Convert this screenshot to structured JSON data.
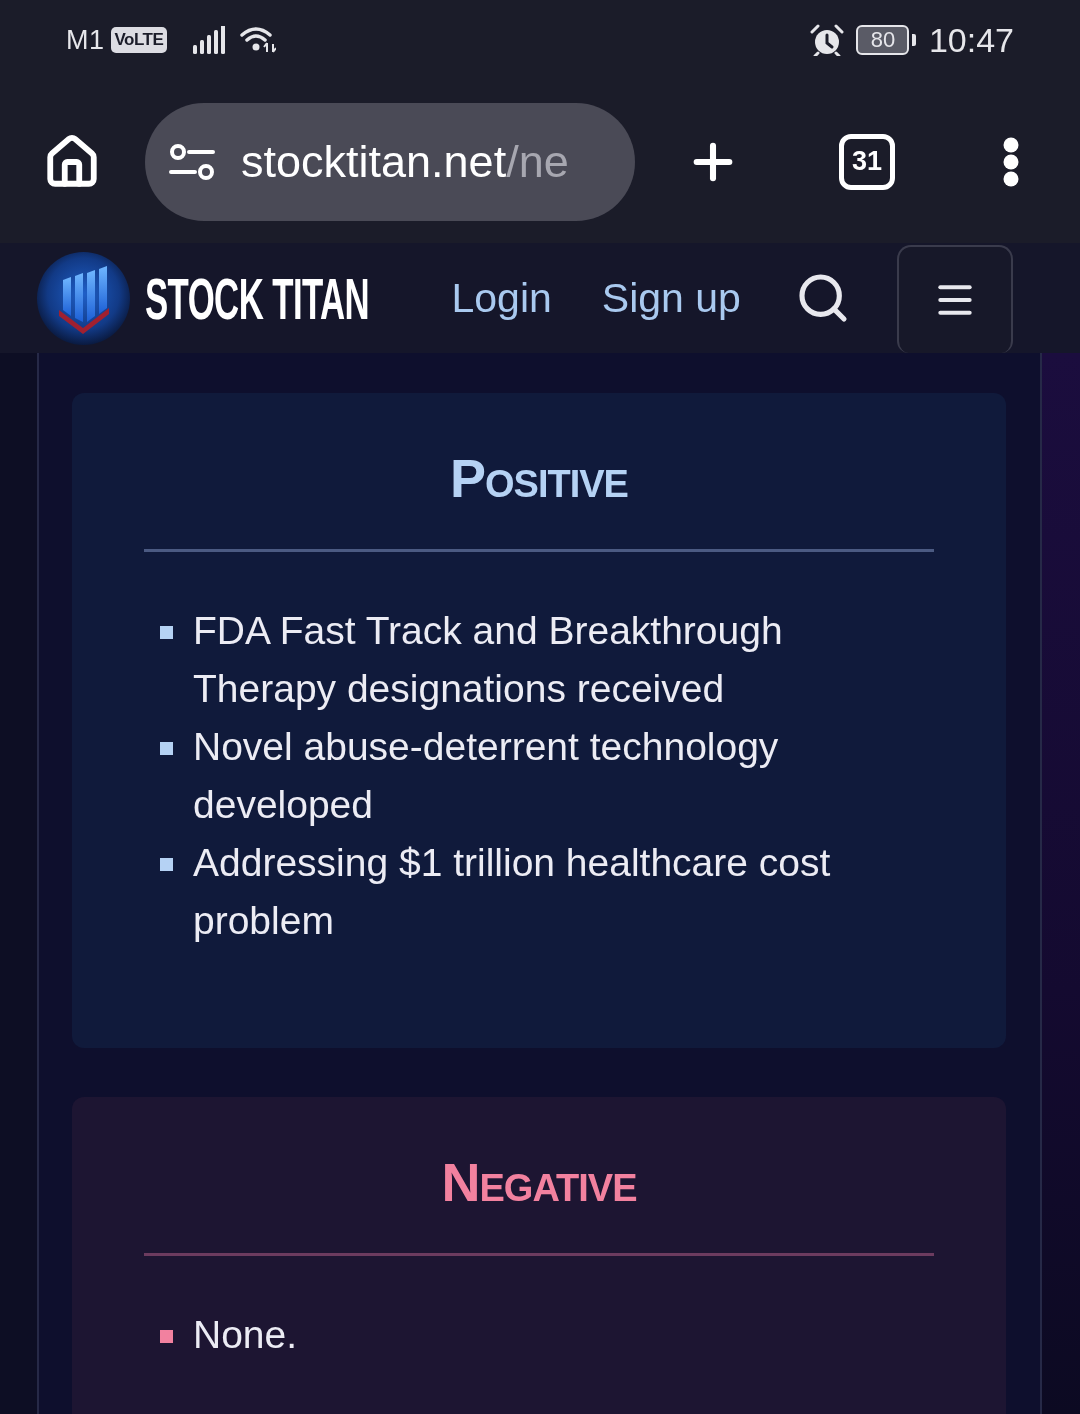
{
  "status_bar": {
    "carrier": "M1",
    "network_badge": "VoLTE",
    "battery": "80",
    "time": "10:47"
  },
  "browser_toolbar": {
    "url_host": "stocktitan.net",
    "url_path": "/ne",
    "tab_count": "31"
  },
  "site_header": {
    "brand": "STOCK TITAN",
    "links": [
      "Login",
      "Sign up"
    ]
  },
  "sentiment_cards": [
    {
      "kind": "positive",
      "title": "POSITIVE",
      "items": [
        "FDA Fast Track and Breakthrough Therapy designations received",
        "Novel abuse-deterrent technology developed",
        "Addressing $1 trillion healthcare cost problem"
      ]
    },
    {
      "kind": "negative",
      "title": "NEGATIVE",
      "items": [
        "None."
      ]
    }
  ]
}
